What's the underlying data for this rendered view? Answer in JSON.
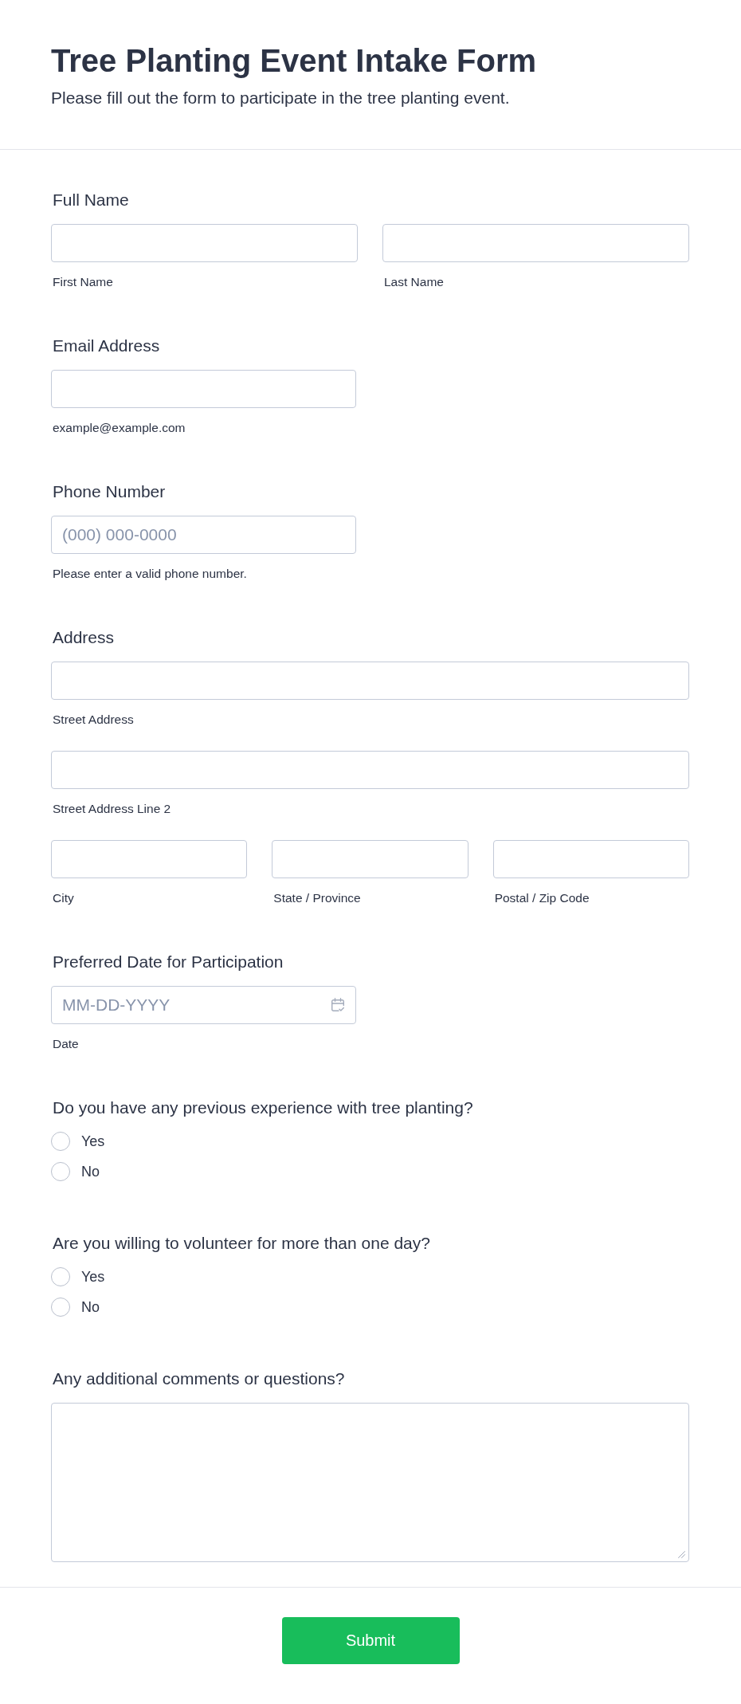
{
  "header": {
    "title": "Tree Planting Event Intake Form",
    "subtitle": "Please fill out the form to participate in the tree planting event."
  },
  "fields": [
    {
      "kind": "grid",
      "label": "Full Name",
      "rows": [
        [
          {
            "sublabel": "First Name"
          },
          {
            "sublabel": "Last Name"
          }
        ]
      ]
    },
    {
      "kind": "short",
      "label": "Email Address",
      "input": {
        "sublabel": "example@example.com"
      }
    },
    {
      "kind": "short",
      "label": "Phone Number",
      "input": {
        "placeholder": "(000) 000-0000",
        "sublabel": "Please enter a valid phone number."
      }
    },
    {
      "kind": "grid",
      "label": "Address",
      "rows": [
        [
          {
            "sublabel": "Street Address"
          }
        ],
        [
          {
            "sublabel": "Street Address Line 2"
          }
        ],
        [
          {
            "sublabel": "City"
          },
          {
            "sublabel": "State / Province"
          },
          {
            "sublabel": "Postal / Zip Code"
          }
        ]
      ]
    },
    {
      "kind": "date",
      "label": "Preferred Date for Participation",
      "input": {
        "placeholder": "MM-DD-YYYY",
        "sublabel": "Date"
      }
    },
    {
      "kind": "radio",
      "label": "Do you have any previous experience with tree planting?",
      "options": [
        {
          "label": "Yes",
          "selected": false
        },
        {
          "label": "No",
          "selected": false
        }
      ]
    },
    {
      "kind": "radio",
      "label": "Are you willing to volunteer for more than one day?",
      "options": [
        {
          "label": "Yes",
          "selected": false
        },
        {
          "label": "No",
          "selected": false
        }
      ]
    },
    {
      "kind": "textarea",
      "label": "Any additional comments or questions?"
    }
  ],
  "submit": {
    "label": "Submit"
  }
}
